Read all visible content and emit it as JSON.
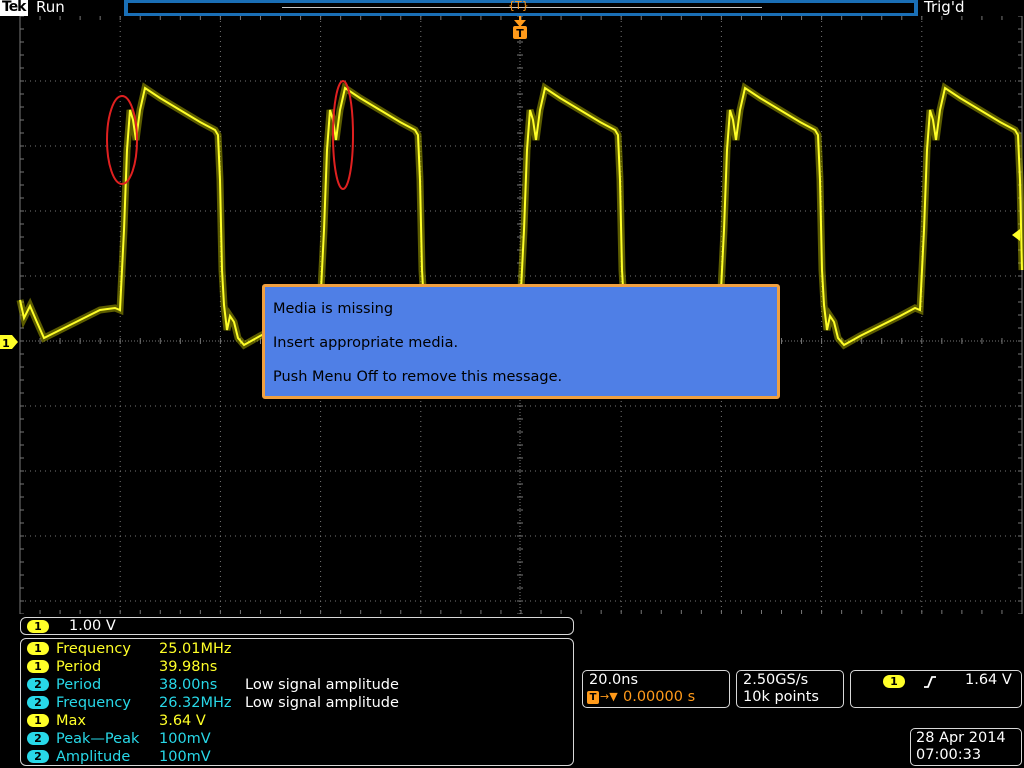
{
  "topbar": {
    "brand": "Tek",
    "run_state": "Run",
    "trigger_status": "Trig'd"
  },
  "dialog": {
    "line1": "Media is missing",
    "line2": "Insert appropriate media.",
    "line3": "Push Menu Off to remove this message."
  },
  "channel_bar": {
    "channel": "1",
    "scale": "1.00 V"
  },
  "measurements": [
    {
      "channel": "1",
      "name": "Frequency",
      "value": "25.01MHz",
      "note": ""
    },
    {
      "channel": "1",
      "name": "Period",
      "value": "39.98ns",
      "note": ""
    },
    {
      "channel": "2",
      "name": "Period",
      "value": "38.00ns",
      "note": "Low signal amplitude"
    },
    {
      "channel": "2",
      "name": "Frequency",
      "value": "26.32MHz",
      "note": "Low signal amplitude"
    },
    {
      "channel": "1",
      "name": "Max",
      "value": "3.64 V",
      "note": ""
    },
    {
      "channel": "2",
      "name": "Peak—Peak",
      "value": "100mV",
      "note": ""
    },
    {
      "channel": "2",
      "name": "Amplitude",
      "value": "100mV",
      "note": ""
    }
  ],
  "timebase": {
    "scale": "20.0ns",
    "trigger_position": "0.00000 s"
  },
  "acquisition": {
    "sample_rate": "2.50GS/s",
    "record_length": "10k points"
  },
  "trigger": {
    "source": "1",
    "level": "1.64 V"
  },
  "datetime": {
    "date": "28 Apr 2014",
    "time": "07:00:33"
  },
  "markers": {
    "trigger_marker": "T",
    "channel1_ground": "1"
  },
  "colors": {
    "channel1": "#ffff28",
    "channel2": "#28d8e8",
    "timebase_accent": "#f0a040",
    "dialog_bg": "#4f7fe6",
    "dialog_border": "#f0a040",
    "annotation": "#e02020"
  }
}
